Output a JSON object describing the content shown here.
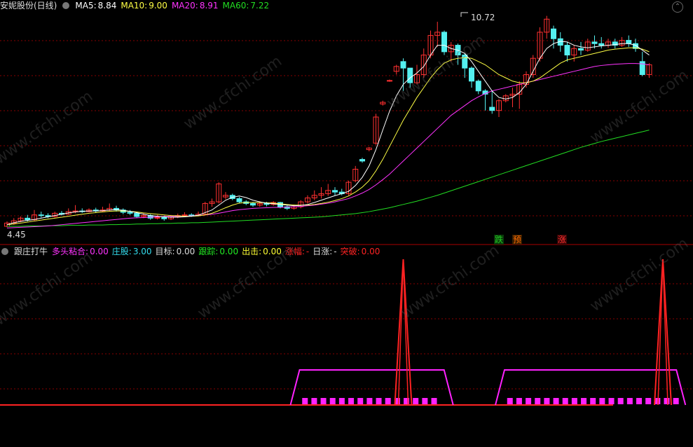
{
  "main_header": {
    "stock_name": "安妮股份(日线)",
    "ma5_label": "MA5:",
    "ma5_value": "8.84",
    "ma10_label": "MA10:",
    "ma10_value": "9.00",
    "ma20_label": "MA20:",
    "ma20_value": "8.91",
    "ma60_label": "MA60:",
    "ma60_value": "7.22"
  },
  "price_labels": {
    "high": "10.72",
    "low": "4.45"
  },
  "signals": [
    {
      "text": "跌",
      "color": "#22cc22"
    },
    {
      "text": "预",
      "color": "#ff6a00"
    },
    {
      "text": "涨",
      "color": "#ff3030"
    }
  ],
  "indicator_header": {
    "name": "跟庄打牛",
    "items": [
      {
        "label": "多头粘合:",
        "value": "0.00",
        "color": "#ff33ff"
      },
      {
        "label": "庄股:",
        "value": "3.00",
        "color": "#33ddee"
      },
      {
        "label": "目标:",
        "value": "0.00",
        "color": "#dddddd"
      },
      {
        "label": "跟踪:",
        "value": "0.00",
        "color": "#22ee22"
      },
      {
        "label": "出击:",
        "value": "0.00",
        "color": "#ffff33"
      },
      {
        "label": "涨幅:",
        "value": "-",
        "color": "#ff2222"
      },
      {
        "label": "日涨:",
        "value": "-",
        "color": "#dddddd"
      },
      {
        "label": "突破:",
        "value": "0.00",
        "color": "#ff2222"
      }
    ]
  },
  "watermark": "www.cfchi.com",
  "colors": {
    "up": "#ff3030",
    "down": "#54f0f0",
    "ma5": "#ffffff",
    "ma10": "#ffff44",
    "ma20": "#ff33ff",
    "ma60": "#22dd22",
    "grid": "#880000"
  },
  "chart_data": {
    "type": "candlestick",
    "price_range": [
      4.45,
      10.72
    ],
    "candles": [
      [
        4.45,
        4.55,
        4.42,
        4.6
      ],
      [
        4.55,
        4.62,
        4.5,
        4.7
      ],
      [
        4.62,
        4.7,
        4.58,
        4.75
      ],
      [
        4.7,
        4.65,
        4.6,
        4.8
      ],
      [
        4.65,
        4.8,
        4.62,
        4.95
      ],
      [
        4.8,
        4.78,
        4.72,
        4.9
      ],
      [
        4.78,
        4.75,
        4.7,
        4.85
      ],
      [
        4.75,
        4.85,
        4.72,
        4.9
      ],
      [
        4.85,
        4.82,
        4.78,
        4.92
      ],
      [
        4.82,
        4.9,
        4.8,
        5.0
      ],
      [
        4.9,
        4.92,
        4.85,
        5.1
      ],
      [
        4.92,
        4.9,
        4.86,
        5.0
      ],
      [
        4.9,
        4.95,
        4.88,
        5.0
      ],
      [
        4.95,
        4.92,
        4.86,
        5.02
      ],
      [
        4.92,
        4.95,
        4.88,
        5.05
      ],
      [
        4.95,
        5.0,
        4.9,
        5.15
      ],
      [
        5.0,
        4.95,
        4.9,
        5.08
      ],
      [
        4.95,
        4.88,
        4.82,
        5.0
      ],
      [
        4.88,
        4.85,
        4.8,
        4.95
      ],
      [
        4.85,
        4.75,
        4.7,
        4.9
      ],
      [
        4.75,
        4.78,
        4.7,
        4.85
      ],
      [
        4.78,
        4.7,
        4.65,
        4.82
      ],
      [
        4.7,
        4.72,
        4.66,
        4.8
      ],
      [
        4.72,
        4.68,
        4.62,
        4.78
      ],
      [
        4.68,
        4.74,
        4.64,
        4.8
      ],
      [
        4.74,
        4.78,
        4.7,
        4.84
      ],
      [
        4.78,
        4.8,
        4.74,
        4.88
      ],
      [
        4.8,
        4.78,
        4.74,
        4.85
      ],
      [
        4.78,
        4.82,
        4.76,
        4.9
      ],
      [
        4.82,
        5.15,
        4.8,
        5.2
      ],
      [
        5.15,
        5.2,
        5.05,
        5.3
      ],
      [
        5.2,
        5.75,
        5.15,
        5.8
      ],
      [
        5.35,
        5.4,
        5.28,
        5.5
      ],
      [
        5.4,
        5.3,
        5.25,
        5.45
      ],
      [
        5.3,
        5.2,
        5.15,
        5.35
      ],
      [
        5.2,
        5.15,
        5.1,
        5.25
      ],
      [
        5.15,
        5.1,
        5.05,
        5.2
      ],
      [
        5.1,
        5.15,
        5.05,
        5.22
      ],
      [
        5.15,
        5.12,
        5.06,
        5.2
      ],
      [
        5.12,
        5.18,
        5.08,
        5.22
      ],
      [
        5.18,
        5.05,
        5.0,
        5.2
      ],
      [
        5.05,
        5.0,
        4.95,
        5.1
      ],
      [
        5.0,
        5.05,
        4.96,
        5.12
      ],
      [
        5.05,
        5.2,
        5.0,
        5.25
      ],
      [
        5.2,
        5.32,
        5.15,
        5.4
      ],
      [
        5.32,
        5.4,
        5.25,
        5.55
      ],
      [
        5.4,
        5.45,
        5.3,
        5.65
      ],
      [
        5.45,
        5.55,
        5.38,
        5.75
      ],
      [
        5.55,
        5.5,
        5.4,
        5.65
      ],
      [
        5.5,
        5.45,
        5.4,
        5.6
      ],
      [
        5.45,
        5.8,
        5.4,
        5.85
      ],
      [
        5.85,
        6.2,
        5.8,
        6.3
      ],
      [
        6.5,
        6.45,
        6.4,
        6.55
      ],
      [
        6.8,
        6.85,
        6.75,
        6.88
      ],
      [
        7.0,
        7.8,
        6.95,
        7.9
      ],
      [
        8.2,
        8.25,
        8.15,
        8.3
      ],
      [
        8.9,
        8.92,
        8.88,
        8.95
      ],
      [
        9.2,
        9.35,
        9.1,
        9.4
      ],
      [
        9.5,
        9.3,
        8.6,
        9.6
      ],
      [
        9.3,
        8.85,
        8.7,
        9.1
      ],
      [
        8.85,
        9.1,
        8.8,
        9.4
      ],
      [
        9.1,
        9.7,
        9.0,
        9.9
      ],
      [
        9.7,
        10.3,
        9.6,
        10.45
      ],
      [
        10.3,
        10.4,
        9.95,
        10.72
      ],
      [
        10.4,
        9.8,
        9.7,
        10.45
      ],
      [
        9.8,
        10.0,
        9.5,
        10.1
      ],
      [
        10.0,
        9.7,
        9.4,
        10.05
      ],
      [
        9.7,
        9.3,
        9.0,
        9.75
      ],
      [
        9.3,
        8.9,
        8.7,
        9.35
      ],
      [
        8.9,
        8.6,
        8.5,
        8.95
      ],
      [
        8.6,
        8.5,
        8.0,
        8.65
      ],
      [
        8.1,
        8.0,
        7.9,
        8.6
      ],
      [
        8.0,
        8.3,
        7.8,
        8.35
      ],
      [
        8.3,
        8.45,
        8.25,
        8.5
      ],
      [
        8.45,
        8.5,
        8.1,
        8.7
      ],
      [
        8.5,
        8.8,
        8.05,
        8.9
      ],
      [
        8.8,
        9.1,
        8.7,
        9.2
      ],
      [
        9.1,
        9.6,
        9.0,
        9.7
      ],
      [
        9.6,
        10.4,
        9.5,
        10.55
      ],
      [
        10.4,
        10.8,
        10.2,
        10.9
      ],
      [
        10.5,
        10.2,
        9.9,
        10.6
      ],
      [
        10.2,
        10.0,
        9.8,
        10.4
      ],
      [
        10.0,
        9.7,
        9.5,
        10.1
      ],
      [
        9.7,
        9.9,
        9.5,
        10.0
      ],
      [
        9.9,
        9.85,
        9.7,
        10.1
      ],
      [
        9.85,
        10.1,
        9.8,
        10.2
      ],
      [
        10.1,
        10.05,
        9.9,
        10.3
      ],
      [
        10.05,
        10.0,
        9.9,
        10.25
      ],
      [
        10.0,
        10.1,
        9.92,
        10.2
      ],
      [
        10.1,
        10.0,
        9.9,
        10.2
      ],
      [
        10.0,
        10.15,
        9.95,
        10.25
      ],
      [
        10.15,
        10.05,
        9.95,
        10.3
      ],
      [
        10.05,
        9.9,
        9.8,
        10.2
      ],
      [
        9.5,
        9.1,
        9.05,
        9.8
      ],
      [
        9.1,
        9.4,
        9.0,
        9.45
      ]
    ],
    "ma5": [
      4.5,
      4.56,
      4.6,
      4.63,
      4.66,
      4.7,
      4.74,
      4.78,
      4.82,
      4.86,
      4.89,
      4.91,
      4.92,
      4.92,
      4.93,
      4.95,
      4.96,
      4.94,
      4.91,
      4.87,
      4.82,
      4.78,
      4.76,
      4.74,
      4.73,
      4.73,
      4.74,
      4.76,
      4.79,
      4.87,
      4.95,
      5.1,
      5.25,
      5.34,
      5.38,
      5.33,
      5.25,
      5.2,
      5.16,
      5.14,
      5.12,
      5.1,
      5.08,
      5.09,
      5.12,
      5.18,
      5.25,
      5.32,
      5.39,
      5.45,
      5.52,
      5.7,
      5.95,
      6.3,
      6.8,
      7.4,
      7.98,
      8.45,
      8.8,
      9.0,
      9.15,
      9.35,
      9.7,
      10.0,
      10.0,
      9.9,
      9.85,
      9.75,
      9.5,
      9.2,
      8.9,
      8.6,
      8.4,
      8.35,
      8.4,
      8.55,
      8.8,
      9.2,
      9.6,
      9.9,
      10.05,
      10.12,
      10.1,
      10.0,
      9.95,
      9.92,
      9.95,
      9.98,
      10.0,
      10.02,
      10.05,
      10.05,
      10.0,
      9.85,
      9.7
    ],
    "ma10": [
      4.5,
      4.52,
      4.55,
      4.58,
      4.61,
      4.64,
      4.67,
      4.7,
      4.73,
      4.76,
      4.79,
      4.82,
      4.85,
      4.87,
      4.89,
      4.91,
      4.92,
      4.92,
      4.91,
      4.89,
      4.86,
      4.84,
      4.82,
      4.8,
      4.78,
      4.77,
      4.76,
      4.76,
      4.77,
      4.8,
      4.85,
      4.93,
      5.02,
      5.1,
      5.16,
      5.18,
      5.18,
      5.18,
      5.17,
      5.16,
      5.14,
      5.12,
      5.1,
      5.1,
      5.1,
      5.12,
      5.15,
      5.19,
      5.24,
      5.3,
      5.38,
      5.5,
      5.65,
      5.85,
      6.15,
      6.5,
      6.9,
      7.3,
      7.7,
      8.05,
      8.4,
      8.7,
      9.0,
      9.25,
      9.45,
      9.55,
      9.6,
      9.62,
      9.6,
      9.5,
      9.4,
      9.25,
      9.1,
      9.0,
      8.9,
      8.85,
      8.85,
      8.9,
      9.0,
      9.15,
      9.3,
      9.45,
      9.55,
      9.6,
      9.65,
      9.7,
      9.75,
      9.8,
      9.85,
      9.88,
      9.9,
      9.92,
      9.92,
      9.88,
      9.8
    ],
    "ma20": [
      4.4,
      4.41,
      4.42,
      4.43,
      4.44,
      4.45,
      4.46,
      4.48,
      4.5,
      4.52,
      4.54,
      4.56,
      4.58,
      4.6,
      4.62,
      4.64,
      4.66,
      4.68,
      4.7,
      4.71,
      4.72,
      4.73,
      4.74,
      4.75,
      4.75,
      4.76,
      4.76,
      4.77,
      4.78,
      4.8,
      4.82,
      4.85,
      4.89,
      4.93,
      4.96,
      4.98,
      5.0,
      5.01,
      5.02,
      5.03,
      5.03,
      5.04,
      5.05,
      5.06,
      5.08,
      5.1,
      5.13,
      5.16,
      5.2,
      5.25,
      5.3,
      5.38,
      5.47,
      5.58,
      5.72,
      5.88,
      6.05,
      6.25,
      6.45,
      6.65,
      6.85,
      7.05,
      7.25,
      7.45,
      7.65,
      7.85,
      8.0,
      8.15,
      8.3,
      8.42,
      8.52,
      8.6,
      8.65,
      8.7,
      8.75,
      8.8,
      8.85,
      8.9,
      8.95,
      9.0,
      9.05,
      9.1,
      9.15,
      9.2,
      9.25,
      9.3,
      9.35,
      9.38,
      9.4,
      9.42,
      9.43,
      9.44,
      9.44,
      9.43,
      9.4
    ],
    "ma60": [
      4.45,
      4.45,
      4.45,
      4.46,
      4.46,
      4.46,
      4.47,
      4.47,
      4.47,
      4.48,
      4.48,
      4.48,
      4.49,
      4.49,
      4.49,
      4.5,
      4.5,
      4.51,
      4.51,
      4.52,
      4.52,
      4.53,
      4.53,
      4.54,
      4.54,
      4.55,
      4.55,
      4.56,
      4.56,
      4.57,
      4.58,
      4.59,
      4.6,
      4.61,
      4.62,
      4.63,
      4.64,
      4.65,
      4.66,
      4.67,
      4.68,
      4.69,
      4.7,
      4.71,
      4.72,
      4.73,
      4.74,
      4.76,
      4.78,
      4.8,
      4.82,
      4.84,
      4.87,
      4.9,
      4.94,
      4.98,
      5.02,
      5.07,
      5.12,
      5.17,
      5.22,
      5.28,
      5.34,
      5.4,
      5.47,
      5.54,
      5.61,
      5.68,
      5.75,
      5.82,
      5.89,
      5.96,
      6.03,
      6.1,
      6.17,
      6.24,
      6.31,
      6.38,
      6.45,
      6.52,
      6.59,
      6.66,
      6.73,
      6.8,
      6.87,
      6.93,
      6.99,
      7.05,
      7.1,
      7.15,
      7.2,
      7.25,
      7.3,
      7.35,
      7.4
    ]
  },
  "indicator_data": {
    "plateaus": [
      {
        "start": 42,
        "end": 65
      },
      {
        "start": 72,
        "end": 99
      }
    ],
    "spikes": [
      {
        "center": 58
      },
      {
        "center": 96
      }
    ],
    "bars": [
      [
        43,
        63
      ],
      [
        73,
        98
      ]
    ]
  }
}
